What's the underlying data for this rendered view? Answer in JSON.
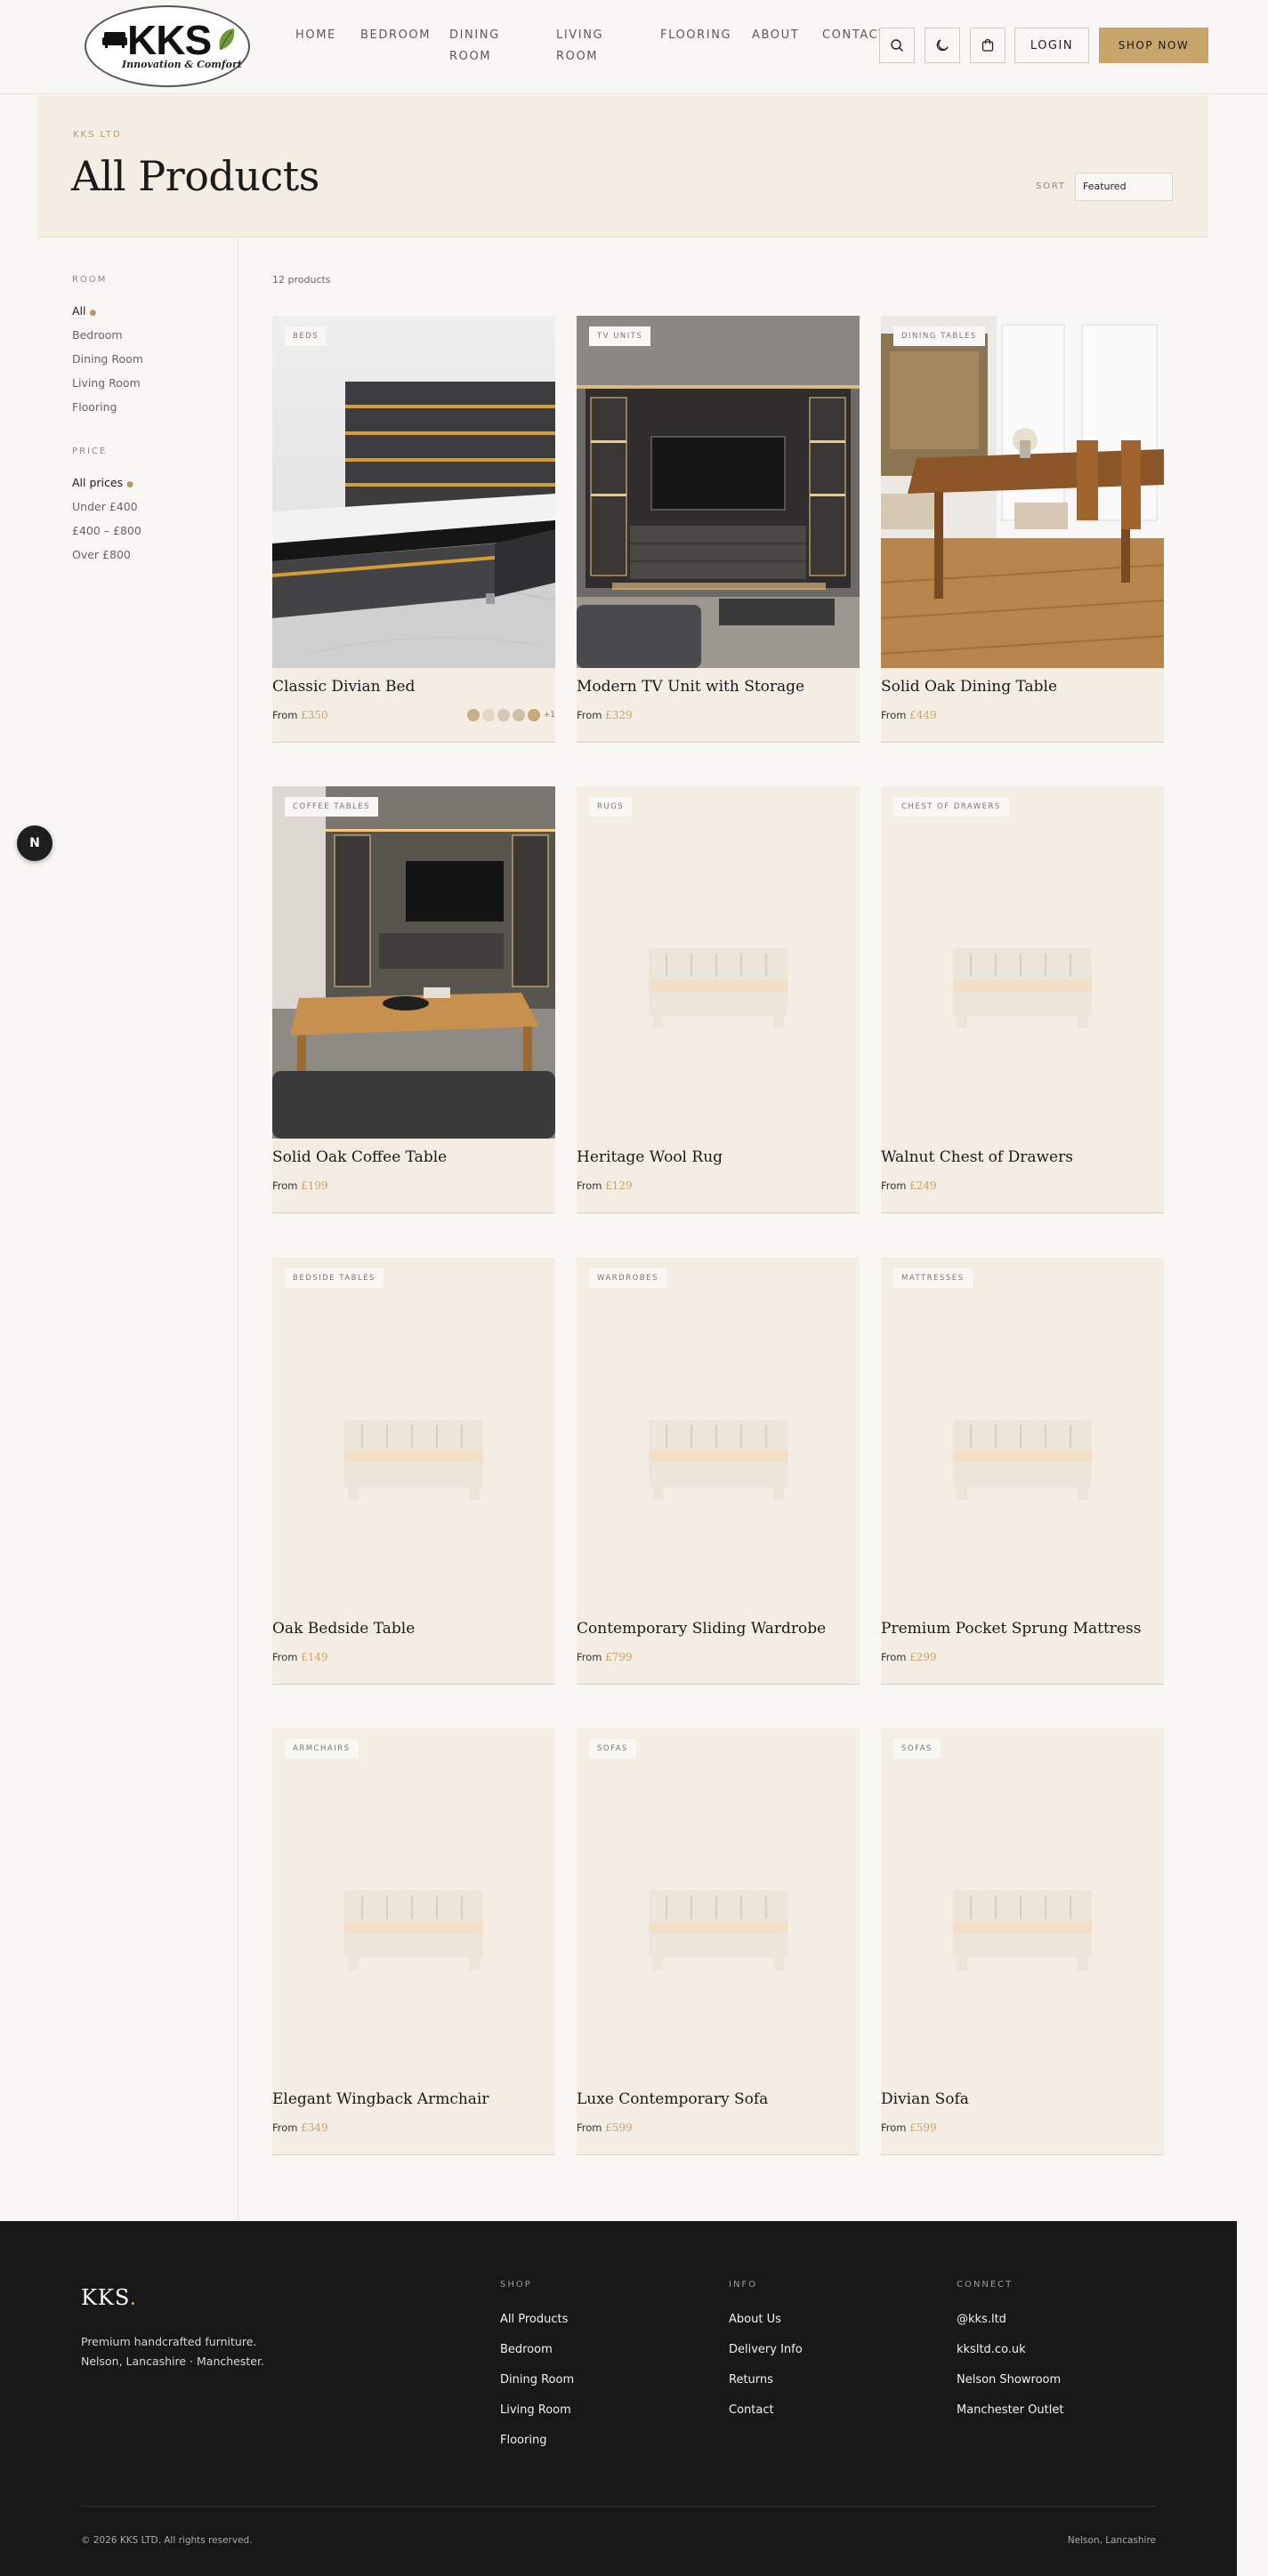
{
  "header": {
    "logo": {
      "name": "KKS",
      "tagline": "Innovation & Comfort"
    },
    "nav": [
      "HOME",
      "BEDROOM",
      "DINING",
      "ROOM",
      "LIVING",
      "ROOM",
      "FLOORING",
      "ABOUT",
      "CONTACT"
    ],
    "icons": [
      "search-icon",
      "moon-icon",
      "cart-icon"
    ],
    "login_label": "LOGIN",
    "shop_label": "SHOP NOW"
  },
  "hero": {
    "eyebrow": "KKS LTD",
    "title": "All Products",
    "sort_label": "SORT",
    "sort_value": "Featured"
  },
  "sidebar": {
    "room_heading": "ROOM",
    "rooms": [
      "All",
      "Bedroom",
      "Dining Room",
      "Living Room",
      "Flooring"
    ],
    "price_heading": "PRICE",
    "prices": [
      "All prices",
      "Under £400",
      "£400 – £800",
      "Over £800"
    ]
  },
  "product_count": "12 products",
  "price_prefix": "From",
  "products": [
    {
      "badge": "BEDS",
      "name": "Classic Divian Bed",
      "price": "£350",
      "image": "bed"
    },
    {
      "badge": "TV UNITS",
      "name": "Modern TV Unit with Storage",
      "price": "£329",
      "image": "tv"
    },
    {
      "badge": "DINING TABLES",
      "name": "Solid Oak Dining Table",
      "price": "£449",
      "image": "dining"
    },
    {
      "badge": "COFFEE TABLES",
      "name": "Solid Oak Coffee Table",
      "price": "£199",
      "image": "coffee"
    },
    {
      "badge": "RUGS",
      "name": "Heritage Wool Rug",
      "price": "£129",
      "image": "placeholder"
    },
    {
      "badge": "CHEST OF DRAWERS",
      "name": "Walnut Chest of Drawers",
      "price": "£249",
      "image": "placeholder"
    },
    {
      "badge": "BEDSIDE TABLES",
      "name": "Oak Bedside Table",
      "price": "£149",
      "image": "placeholder"
    },
    {
      "badge": "WARDROBES",
      "name": "Contemporary Sliding Wardrobe",
      "price": "£799",
      "image": "placeholder"
    },
    {
      "badge": "MATTRESSES",
      "name": "Premium Pocket Sprung Mattress",
      "price": "£299",
      "image": "placeholder"
    },
    {
      "badge": "ARMCHAIRS",
      "name": "Elegant Wingback Armchair",
      "price": "£349",
      "image": "placeholder"
    },
    {
      "badge": "SOFAS",
      "name": "Luxe Contemporary Sofa",
      "price": "£599",
      "image": "placeholder"
    },
    {
      "badge": "SOFAS",
      "name": "Divian Sofa",
      "price": "£599",
      "image": "placeholder"
    }
  ],
  "swatches": {
    "colors": [
      "#c9b08a",
      "#e4d7c1",
      "#d4c7b3",
      "#cdbfa8",
      "#c6a978"
    ],
    "more": "+1"
  },
  "fab_label": "N",
  "footer": {
    "logo": "KKS",
    "logo_dot": ".",
    "desc_line1": "Premium handcrafted furniture.",
    "desc_line2": "Nelson, Lancashire · Manchester.",
    "shop_heading": "SHOP",
    "shop_links": [
      "All Products",
      "Bedroom",
      "Dining Room",
      "Living Room",
      "Flooring"
    ],
    "info_heading": "INFO",
    "info_links": [
      "About Us",
      "Delivery Info",
      "Returns",
      "Contact"
    ],
    "connect_heading": "CONNECT",
    "connect_links": [
      "@kks.ltd",
      "kksltd.co.uk",
      "Nelson Showroom",
      "Manchester Outlet"
    ],
    "copyright": "© 2026 KKS LTD. All rights reserved.",
    "location": "Nelson, Lancashire"
  },
  "colors": {
    "accent": "#c8a56a",
    "card_bg": "#f3ede3",
    "page_bg": "#f9f7f3",
    "footer_bg": "#181818"
  }
}
